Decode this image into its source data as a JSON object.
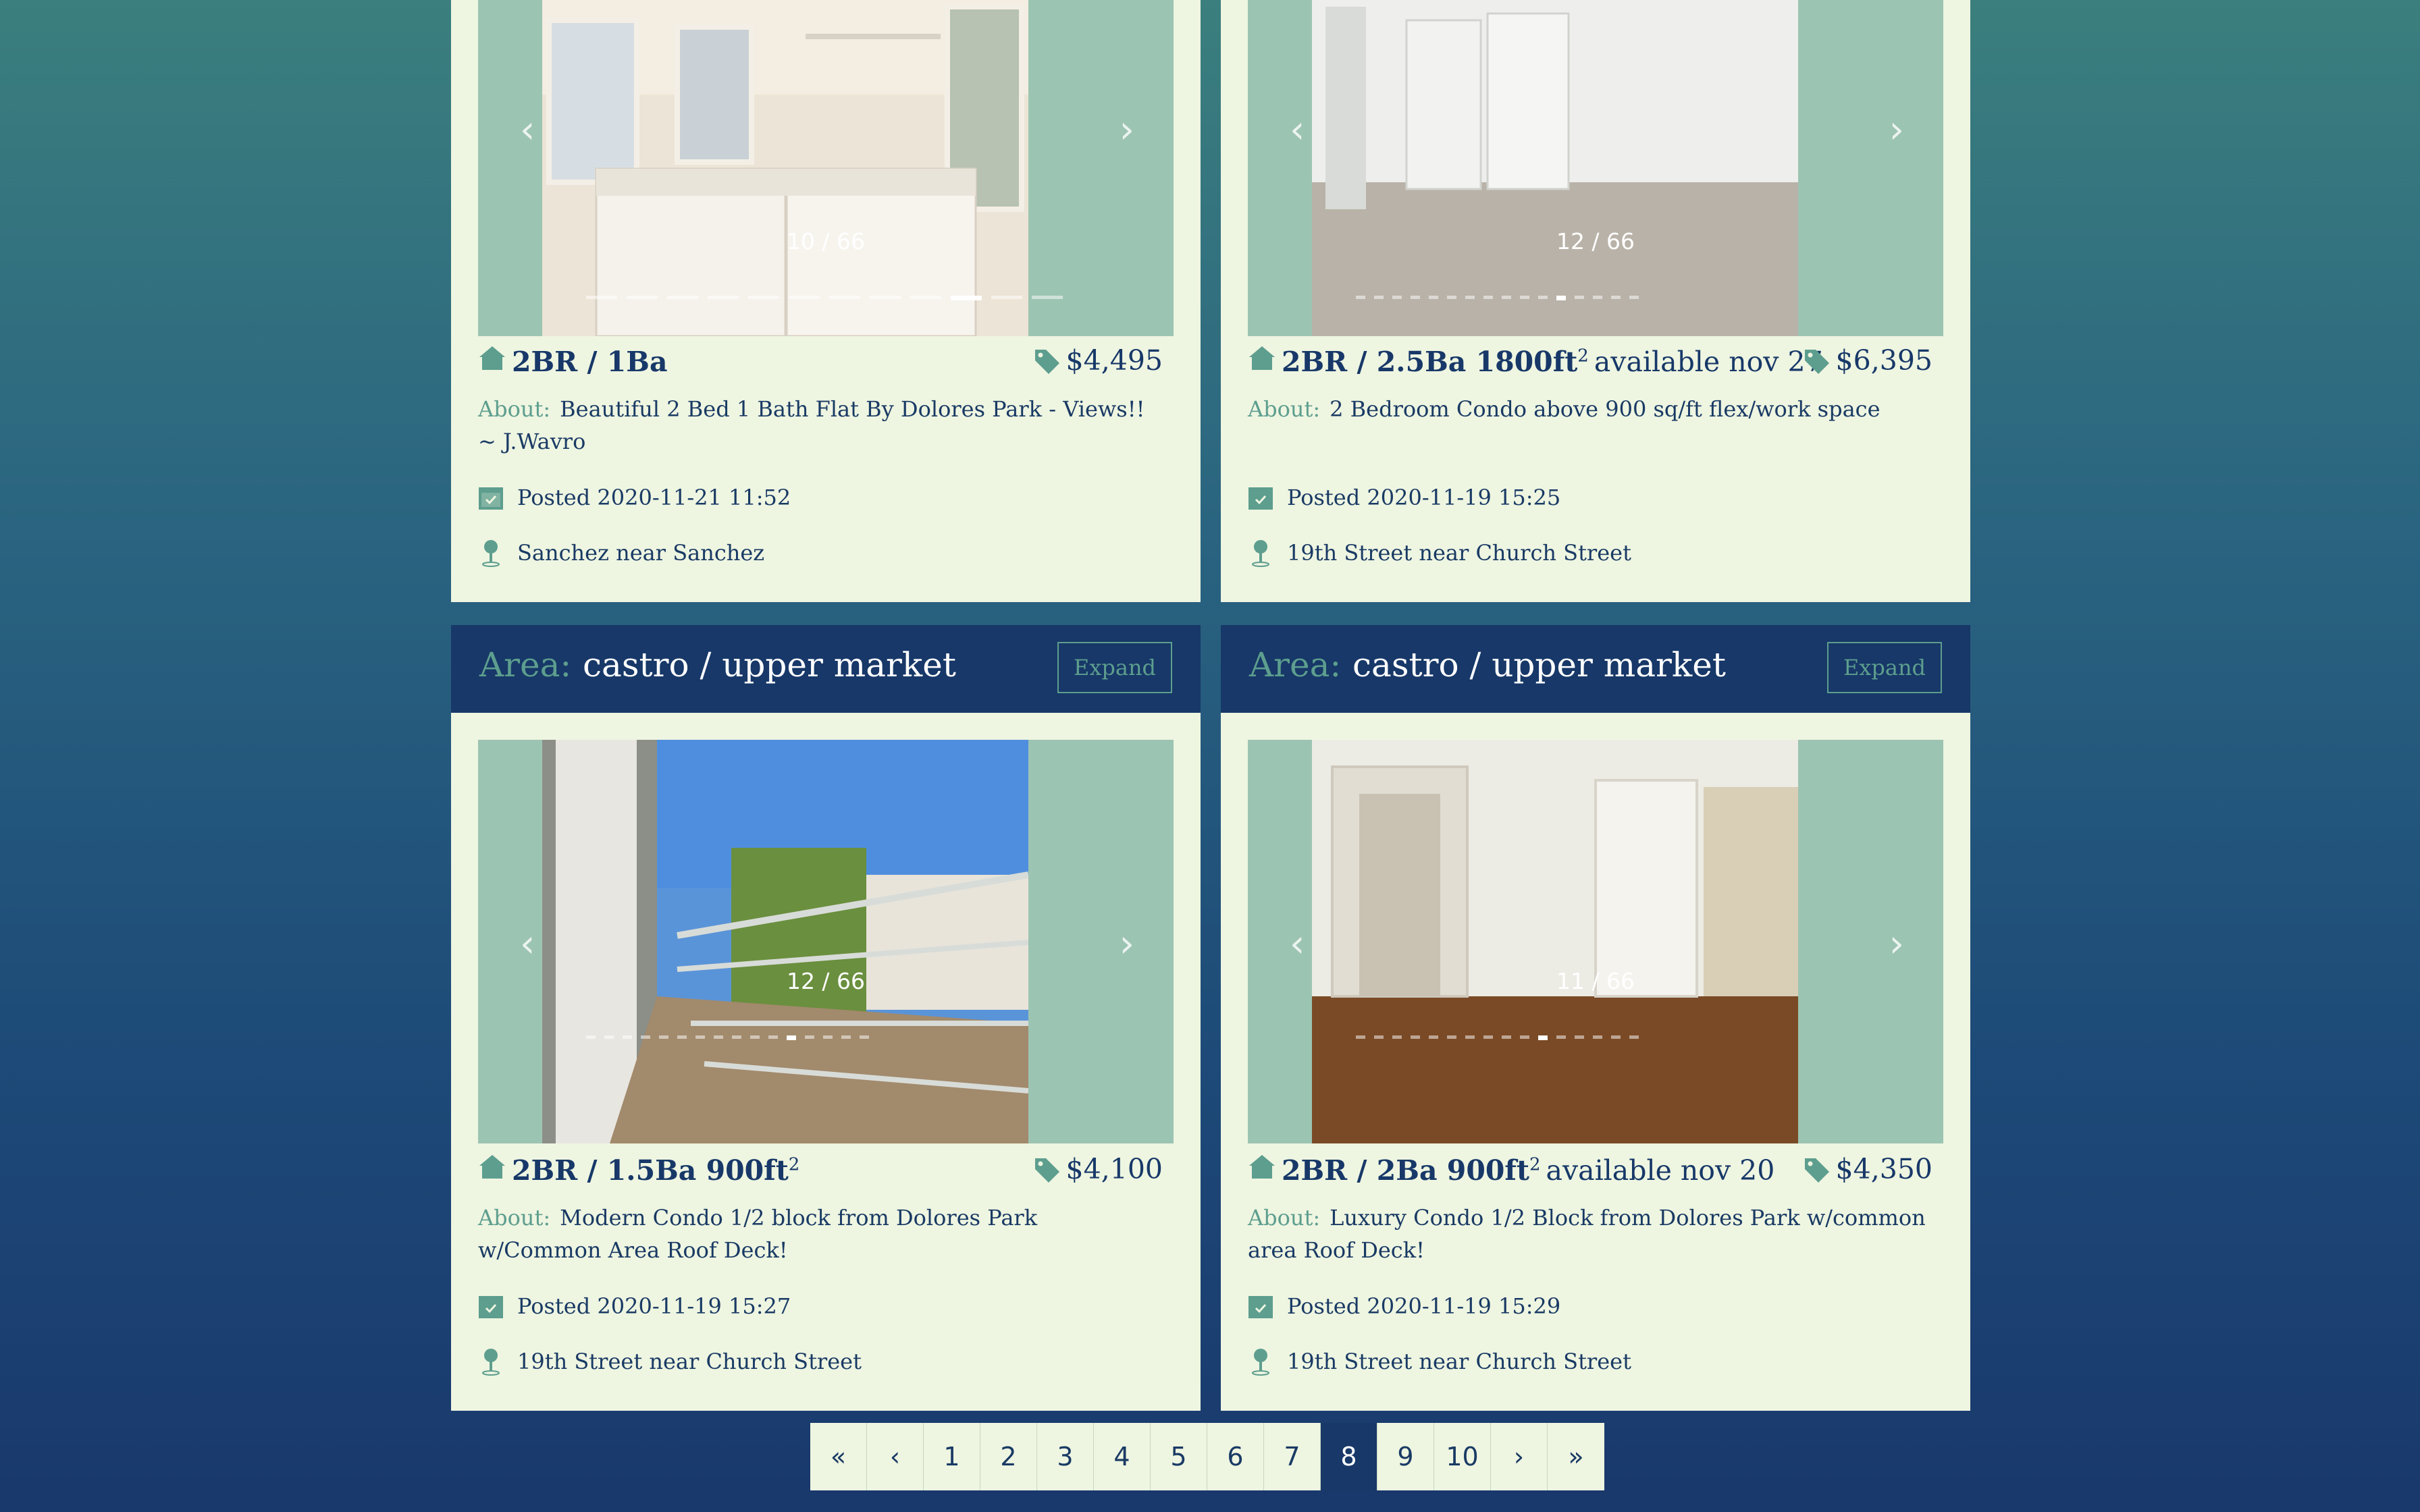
{
  "colors": {
    "accent": "#5d9e8e",
    "navy": "#173868",
    "card": "#eef5e1"
  },
  "listings": [
    {
      "counter": "10 / 66",
      "beds": "2BR / 1Ba",
      "extra": "",
      "price": "$4,495",
      "about_label": "About:",
      "about": "Beautiful 2 Bed 1 Bath Flat By Dolores Park - Views!! ~ J.Wavro",
      "posted": "Posted 2020-11-21 11:52",
      "location": "Sanchez near Sanchez",
      "active_dot": 9
    },
    {
      "counter": "12 / 66",
      "beds": "2BR / 2.5Ba 1800ft",
      "sup": "2",
      "extra": "available nov 27",
      "price": "$6,395",
      "about_label": "About:",
      "about": "2 Bedroom Condo above 900 sq/ft flex/work space",
      "posted": "Posted 2020-11-19 15:25",
      "location": "19th Street near Church Street",
      "active_dot": 11
    },
    {
      "area_label": "Area:",
      "area": "castro / upper market",
      "expand": "Expand",
      "counter": "12 / 66",
      "beds": "2BR / 1.5Ba 900ft",
      "sup": "2",
      "extra": "",
      "price": "$4,100",
      "about_label": "About:",
      "about": "Modern Condo 1/2 block from Dolores Park w/Common Area Roof Deck!",
      "posted": "Posted 2020-11-19 15:27",
      "location": "19th Street near Church Street",
      "active_dot": 11
    },
    {
      "area_label": "Area:",
      "area": "castro / upper market",
      "expand": "Expand",
      "counter": "11 / 66",
      "beds": "2BR / 2Ba 900ft",
      "sup": "2",
      "extra": "available nov 20",
      "price": "$4,350",
      "about_label": "About:",
      "about": "Luxury Condo 1/2 Block from Dolores Park w/common area Roof Deck!",
      "posted": "Posted 2020-11-19 15:29",
      "location": "19th Street near Church Street",
      "active_dot": 10
    }
  ],
  "pagination": {
    "items": [
      "«",
      "‹",
      "1",
      "2",
      "3",
      "4",
      "5",
      "6",
      "7",
      "8",
      "9",
      "10",
      "›",
      "»"
    ],
    "active": "8"
  }
}
